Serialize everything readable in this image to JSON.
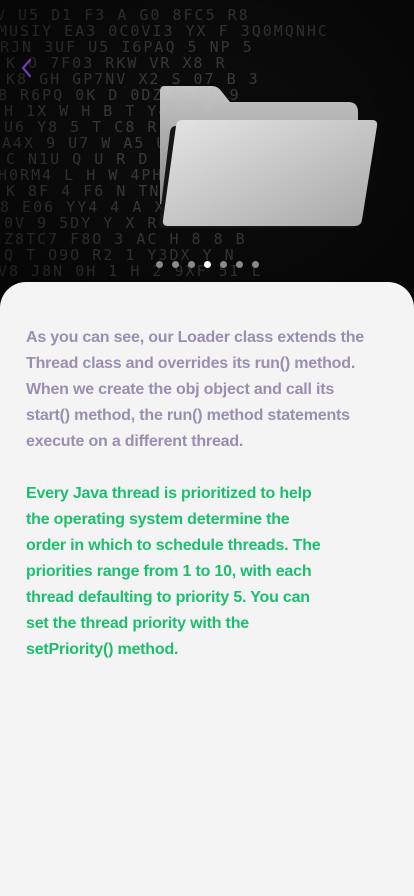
{
  "hero": {
    "image": "folder-icon",
    "background": "matrix-code",
    "back_icon": "chevron-left-icon",
    "colors": {
      "background": "#0b0b0b",
      "code_glyph": "#3a3a3a",
      "back_arrow": "#6b3fb0"
    }
  },
  "pager": {
    "total": 7,
    "active_index": 3,
    "colors": {
      "active": "#ffffff",
      "inactive": "#8a8a8a"
    }
  },
  "content": {
    "paragraph_1": "As you can see, our Loader class extends the Thread class and overrides its run() method. When we create the obj object and call its start() method, the run() method statements execute on a different thread.",
    "paragraph_2": "Every Java thread is prioritized to help the operating system determine the order in which to schedule threads. The priorities range from 1 to 10, with each thread defaulting to priority 5. You can set the thread priority with the setPriority() method.",
    "colors": {
      "paragraph_1": "#9a8fb0",
      "paragraph_2": "#1dbf6e",
      "card": "#f4f4f4"
    }
  }
}
